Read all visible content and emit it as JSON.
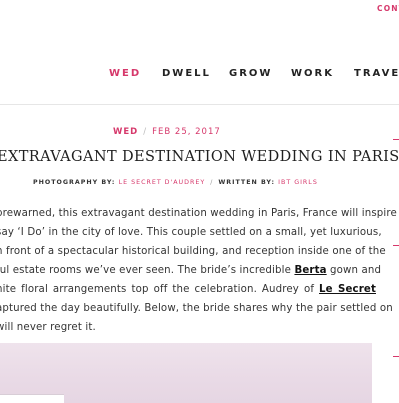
{
  "top_link": "CONT",
  "nav": [
    "WED",
    "DWELL",
    "GROW",
    "WORK",
    "TRAVEL"
  ],
  "active_nav": "WED",
  "post": {
    "category": "WED",
    "date": "FEB 25, 2017",
    "title": "EXTRAVAGANT DESTINATION WEDDING IN PARIS",
    "photography_label": "PHOTOGRAPHY BY:",
    "photographer": "LE SECRET D'AUDREY",
    "written_label": "WRITTEN BY:",
    "author": "IBT GIRLS",
    "body_lines": [
      "prewarned, this extravagant destination wedding in Paris, France will inspire",
      "say ‘I Do’ in the city of love. This couple settled on a small, yet luxurious,",
      "n front of a spectacular historical building, and reception inside one of the",
      "ful estate rooms we’ve ever seen. The bride’s incredible ",
      " gown and",
      "hite floral arrangements top off the celebration. Audrey of ",
      "aptured the day beautifully. Below, the bride shares why the pair settled on",
      "will never regret it."
    ],
    "link_berta": "Berta",
    "link_lesecret": "Le Secret"
  },
  "colors": {
    "accent": "#d6386b",
    "text": "#333333",
    "photo": "#ebdde8"
  }
}
